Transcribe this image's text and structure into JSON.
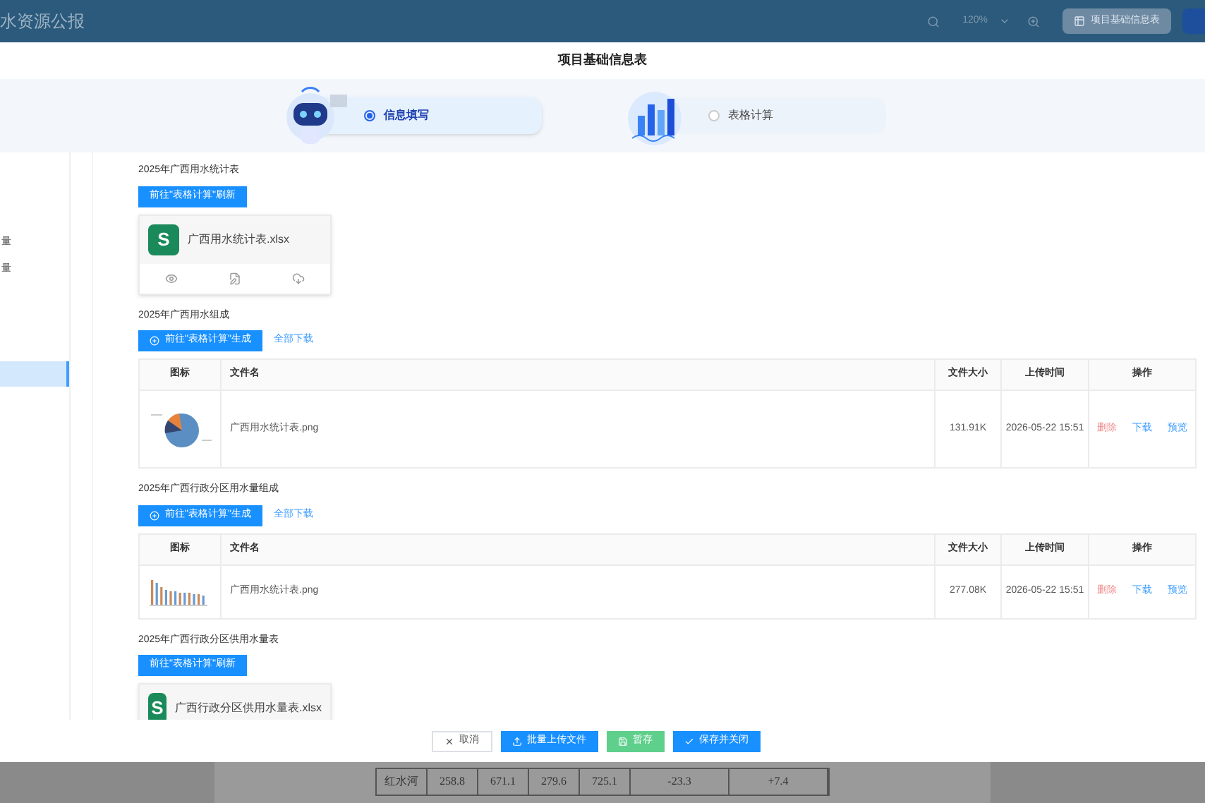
{
  "app_header": {
    "title": "水资源公报",
    "zoom": "120%",
    "tab_button": "项目基础信息表"
  },
  "modal": {
    "title": "项目基础信息表",
    "steps": [
      {
        "label": "信息填写",
        "selected": true,
        "kind": "robot"
      },
      {
        "label": "表格计算",
        "selected": false,
        "kind": "chart"
      }
    ],
    "sidebar": {
      "items": [
        {
          "label": "量",
          "selected": false
        },
        {
          "label": "量",
          "selected": false
        },
        {
          "selected": true
        }
      ]
    },
    "sections": [
      {
        "kind": "file-card",
        "title": "2025年广西用水统计表",
        "action": "前往\"表格计算\"刷新",
        "icon_letter": "S",
        "file": "广西用水统计表.xlsx"
      },
      {
        "kind": "image-table",
        "title": "2025年广西用水组成",
        "action": "前往\"表格计算\"生成",
        "download_all": "全部下载",
        "columns": [
          "图标",
          "文件名",
          "文件大小",
          "上传时间",
          "操作"
        ],
        "rows": [
          {
            "kind": "pie",
            "name": "广西用水统计表.png",
            "size": "131.91K",
            "time": "2026-05-22 15:51",
            "ops": [
              "删除",
              "下载",
              "预览"
            ]
          }
        ]
      },
      {
        "kind": "image-table",
        "title": "2025年广西行政分区用水量组成",
        "action": "前往\"表格计算\"生成",
        "download_all": "全部下载",
        "columns": [
          "图标",
          "文件名",
          "文件大小",
          "上传时间",
          "操作"
        ],
        "rows": [
          {
            "kind": "bars",
            "name": "广西用水统计表.png",
            "size": "277.08K",
            "time": "2026-05-22 15:51",
            "ops": [
              "删除",
              "下载",
              "预览"
            ]
          }
        ]
      },
      {
        "kind": "file-card",
        "title": "2025年广西行政分区供用水量表",
        "action": "前往\"表格计算\"刷新",
        "icon_letter": "S",
        "file": "广西行政分区供用水量表.xlsx"
      }
    ],
    "footer": [
      {
        "label": "取消",
        "kind": "cancel"
      },
      {
        "label": "批量上传文件",
        "kind": "upload"
      },
      {
        "label": "暂存",
        "kind": "save-draft"
      },
      {
        "label": "保存并关闭",
        "kind": "save-close"
      }
    ]
  },
  "background_table": {
    "cells": [
      "红水河",
      "258.8",
      "671.1",
      "279.6",
      "725.1",
      "-23.3",
      "+7.4"
    ]
  }
}
